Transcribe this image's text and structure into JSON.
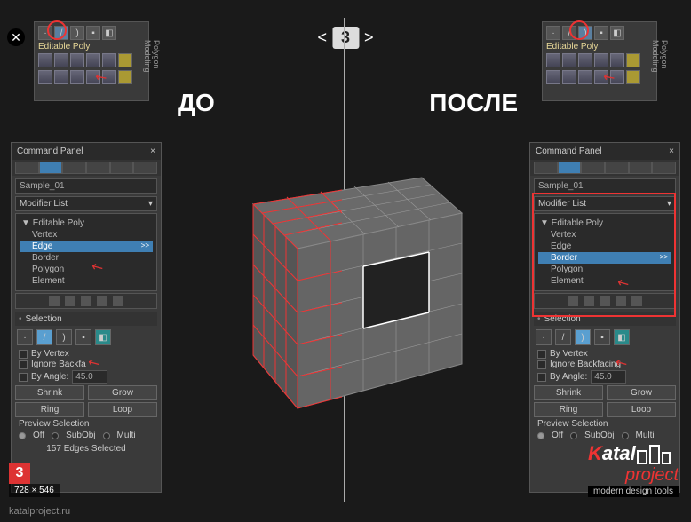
{
  "labels": {
    "before": "ДО",
    "after": "ПОСЛЕ",
    "centerNum": "3",
    "editable_poly": "Editable Poly",
    "vertical_label": "Polygon Modeling"
  },
  "panel": {
    "title": "Command Panel",
    "sample": "Sample_01",
    "modifier_list": "Modifier List",
    "tree_root": "Editable Poly",
    "sub_items": [
      "Vertex",
      "Edge",
      "Border",
      "Polygon",
      "Element"
    ],
    "selection_header": "Selection",
    "by_vertex": "By Vertex",
    "ignore_backfacing_short": "Ignore Backfa",
    "ignore_backfacing": "Ignore Backfacing",
    "by_angle": "By Angle:",
    "angle_value": "45.0",
    "shrink": "Shrink",
    "grow": "Grow",
    "ring": "Ring",
    "loop": "Loop",
    "preview_selection": "Preview Selection",
    "off": "Off",
    "subobj": "SubObj",
    "multi": "Multi",
    "status_left": "157 Edges Selected"
  },
  "dims": "728 × 546",
  "footer": "katalproject.ru",
  "logo": {
    "katal": "Katal",
    "project": "project",
    "tagline": "modern design tools"
  }
}
